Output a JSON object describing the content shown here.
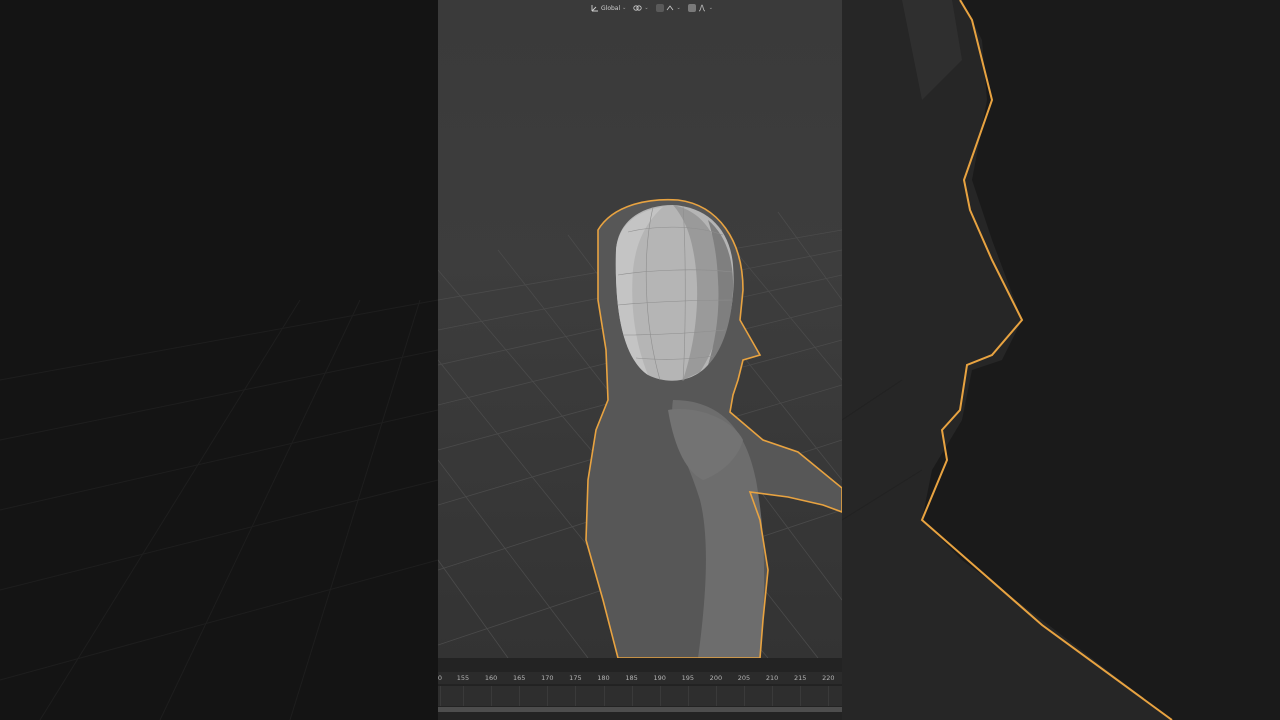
{
  "header": {
    "transform_orientation": "Global",
    "pivot_icon": "pivot-point-icon",
    "snap_icon": "snap-magnet-icon",
    "proportional_icon": "proportional-edit-icon",
    "falloff_icon": "falloff-curve-icon"
  },
  "timeline": {
    "frames": [
      "0",
      "155",
      "160",
      "165",
      "170",
      "175",
      "180",
      "185",
      "190",
      "195",
      "200",
      "205",
      "210",
      "215",
      "220"
    ]
  },
  "colors": {
    "selection_outline": "#e8a341",
    "head_surface": "#b9b9b9",
    "body_surface": "#6a6a6a"
  }
}
